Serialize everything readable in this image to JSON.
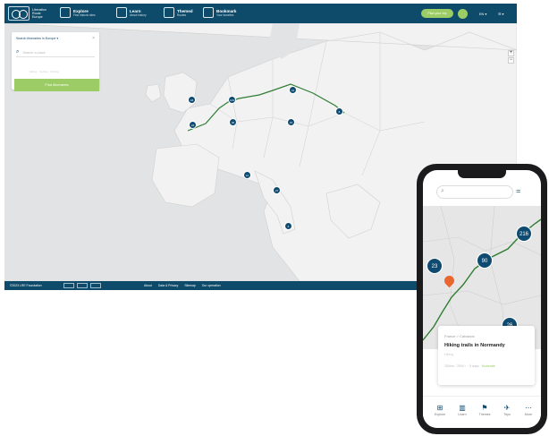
{
  "header": {
    "brand": "Liberation Route Europe",
    "nav": [
      {
        "label": "Explore",
        "sub": "Find historic sites"
      },
      {
        "label": "Learn",
        "sub": "About history"
      },
      {
        "label": "Themed",
        "sub": "Routes"
      },
      {
        "label": "Bookmark",
        "sub": "Your favorites"
      }
    ],
    "cta": "Plan your trip",
    "lang": "EN ▾",
    "menu": "☰ ▾"
  },
  "search_panel": {
    "title": "Search itineraries in Europe ▾",
    "placeholder": "Search a place",
    "options": "Hiking · Cycling · Driving",
    "button": "Find itineraries"
  },
  "clusters": [
    {
      "label": "18"
    },
    {
      "label": "123"
    },
    {
      "label": "41"
    },
    {
      "label": "24"
    },
    {
      "label": "30"
    },
    {
      "label": "15"
    },
    {
      "label": "8"
    },
    {
      "label": "11"
    },
    {
      "label": "27"
    },
    {
      "label": "6"
    }
  ],
  "footer": {
    "copyright": "©2023 LRE Foundation",
    "links": [
      "About",
      "Data & Privacy",
      "Sitemap",
      "Our operation"
    ]
  },
  "phone": {
    "clusters": [
      {
        "label": "23"
      },
      {
        "label": "90"
      },
      {
        "label": "216"
      },
      {
        "label": "26"
      }
    ],
    "card": {
      "breadcrumb": "France > Calvados",
      "title": "Hiking trails in Normandy",
      "type": "Hiking",
      "meta": "250km · 2500 ↑ · 5 days · ",
      "meta_highlight": "Moderate"
    },
    "tabs": [
      {
        "icon": "⊞",
        "label": "Explore"
      },
      {
        "icon": "▥",
        "label": "Learn"
      },
      {
        "icon": "⚑",
        "label": "Themes"
      },
      {
        "icon": "✈",
        "label": "Trips"
      },
      {
        "icon": "⋯",
        "label": "More"
      }
    ]
  },
  "colors": {
    "primary": "#0e4a6a",
    "accent": "#9ccc65",
    "route": "#2f7d32",
    "pin": "#e9662e"
  }
}
